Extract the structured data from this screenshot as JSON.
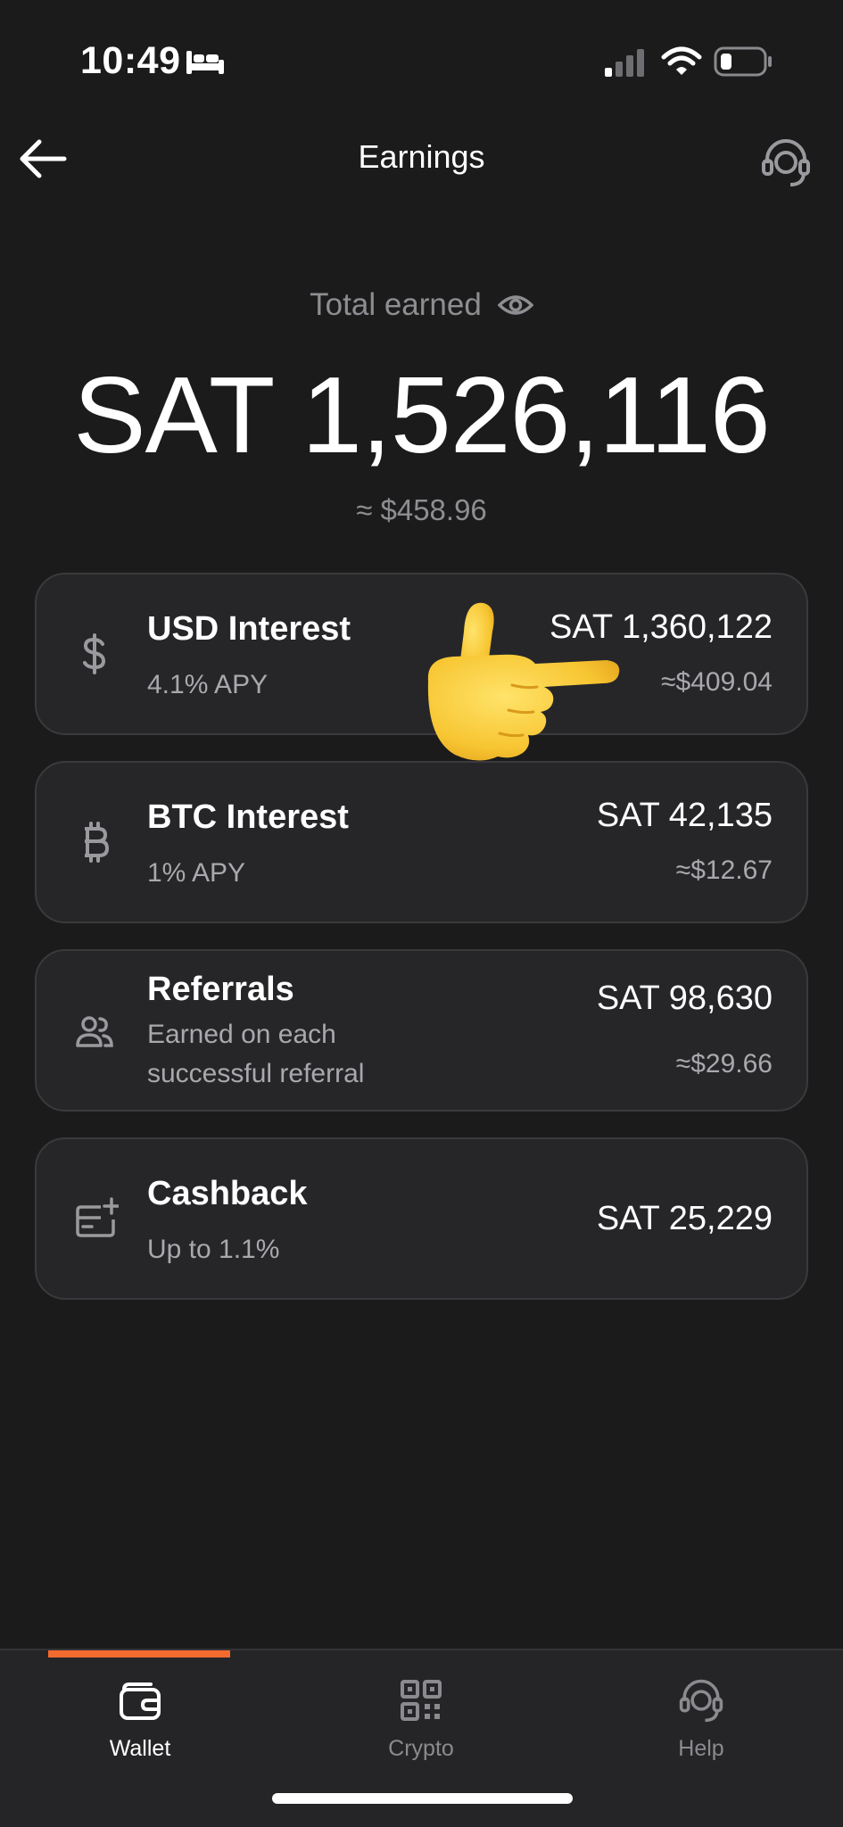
{
  "status_bar": {
    "time": "10:49",
    "icons": [
      "bed-icon",
      "signal-icon",
      "wifi-icon",
      "battery-icon"
    ]
  },
  "header": {
    "title": "Earnings",
    "back_icon": "arrow-left-icon",
    "support_icon": "headset-icon"
  },
  "total": {
    "label": "Total earned",
    "value": "SAT 1,526,116",
    "usd": "≈ $458.96"
  },
  "cards": [
    {
      "title": "USD Interest",
      "subtitle": "4.1% APY",
      "amount": "SAT 1,360,122",
      "usd": "≈$409.04",
      "icon": "dollar-icon"
    },
    {
      "title": "BTC Interest",
      "subtitle": "1% APY",
      "amount": "SAT 42,135",
      "usd": "≈$12.67",
      "icon": "bitcoin-icon"
    },
    {
      "title": "Referrals",
      "subtitle_line1": "Earned on each",
      "subtitle_line2": "successful referral",
      "amount": "SAT 98,630",
      "usd": "≈$29.66",
      "icon": "users-icon"
    },
    {
      "title": "Cashback",
      "subtitle": "Up to 1.1%",
      "amount": "SAT 25,229",
      "icon": "card-plus-icon"
    }
  ],
  "bottom_nav": {
    "items": [
      {
        "label": "Wallet",
        "icon": "wallet-icon",
        "active": true
      },
      {
        "label": "Crypto",
        "icon": "qr-icon",
        "active": false
      },
      {
        "label": "Help",
        "icon": "headset-icon",
        "active": false
      }
    ]
  },
  "colors": {
    "background": "#1b1b1c",
    "card": "#262629",
    "accent": "#f26a2e",
    "muted_text": "#8e8e92"
  }
}
